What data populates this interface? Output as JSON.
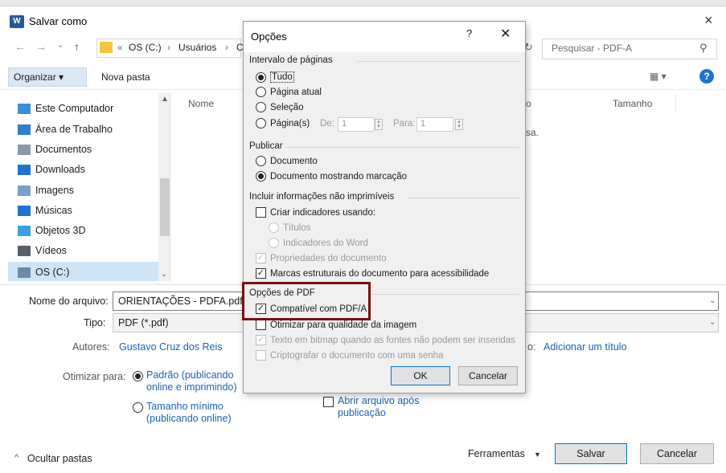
{
  "main": {
    "title": "Salvar como",
    "app_icon": "W",
    "close": "×",
    "nav": {
      "back": "←",
      "forward": "→",
      "recent": "⌄",
      "up": "↑"
    },
    "breadcrumb": [
      "«",
      "OS (C:)",
      "›",
      "Usuários",
      "›",
      "C"
    ],
    "search_placeholder": "Pesquisar - PDF-A",
    "toolbar": {
      "organize": "Organizar ▾",
      "new_folder": "Nova pasta"
    },
    "sidebar": [
      {
        "label": "Este Computador",
        "icon": "computer-icon",
        "color": "#3a8fd8"
      },
      {
        "label": "Área de Trabalho",
        "icon": "desktop-icon",
        "color": "#2f7fd0"
      },
      {
        "label": "Documentos",
        "icon": "documents-icon",
        "color": "#8c9aa8"
      },
      {
        "label": "Downloads",
        "icon": "downloads-icon",
        "color": "#1e73d2"
      },
      {
        "label": "Imagens",
        "icon": "pictures-icon",
        "color": "#7aa0c4"
      },
      {
        "label": "Músicas",
        "icon": "music-icon",
        "color": "#1e73d2"
      },
      {
        "label": "Objetos 3D",
        "icon": "3d-objects-icon",
        "color": "#3aa0e0"
      },
      {
        "label": "Vídeos",
        "icon": "videos-icon",
        "color": "#555e6a"
      },
      {
        "label": "OS (C:)",
        "icon": "drive-icon",
        "color": "#6a8aa8"
      }
    ],
    "columns": {
      "name": "Nome",
      "right_fragment": "o",
      "size": "Tamanho"
    },
    "list_fragment": "sa.",
    "form": {
      "filename_label": "Nome do arquivo:",
      "filename_value": "ORIENTAÇÕES - PDFA.pdf",
      "type_label": "Tipo:",
      "type_value": "PDF (*.pdf)",
      "authors_label": "Autores:",
      "authors_value": "Gustavo Cruz dos Reis",
      "title_fragment": "o:",
      "title_link": "Adicionar um título",
      "optimize_label": "Otimizar para:",
      "opt_standard": "Padrão (publicando online e imprimindo)",
      "opt_minimum": "Tamanho mínimo (publicando online)",
      "open_after": "Abrir arquivo após publicação"
    },
    "footer": {
      "hide_folders": "Ocultar pastas",
      "tools": "Ferramentas",
      "save": "Salvar",
      "cancel": "Cancelar"
    }
  },
  "options": {
    "title": "Opções",
    "help": "?",
    "close": "✕",
    "page_range": {
      "label": "Intervalo de páginas",
      "all": "Tudo",
      "current": "Página atual",
      "selection": "Seleção",
      "pages": "Página(s)",
      "from_label": "De:",
      "from_value": "1",
      "to_label": "Para:",
      "to_value": "1"
    },
    "publish": {
      "label": "Publicar",
      "document": "Documento",
      "markup": "Documento mostrando marcação"
    },
    "nonprint": {
      "label": "Incluir informações não imprimíveis",
      "bookmarks": "Criar indicadores usando:",
      "headings": "Títulos",
      "word_bookmarks": "Indicadores do Word",
      "properties": "Propriedades do documento",
      "structure_tags": "Marcas estruturais do documento para acessibilidade"
    },
    "pdf": {
      "label": "Opções de PDF",
      "pdfa": "Compatível com PDF/A",
      "optimize_image": "Otimizar para qualidade da imagem",
      "bitmap_text": "Texto em bitmap quando as fontes não podem ser inseridas",
      "encrypt": "Criptografar o documento com uma senha"
    },
    "ok": "OK",
    "cancel": "Cancelar"
  },
  "colors": {
    "accent": "#0078d7",
    "highlight_box": "#7a1111",
    "link": "#1a62b3"
  }
}
